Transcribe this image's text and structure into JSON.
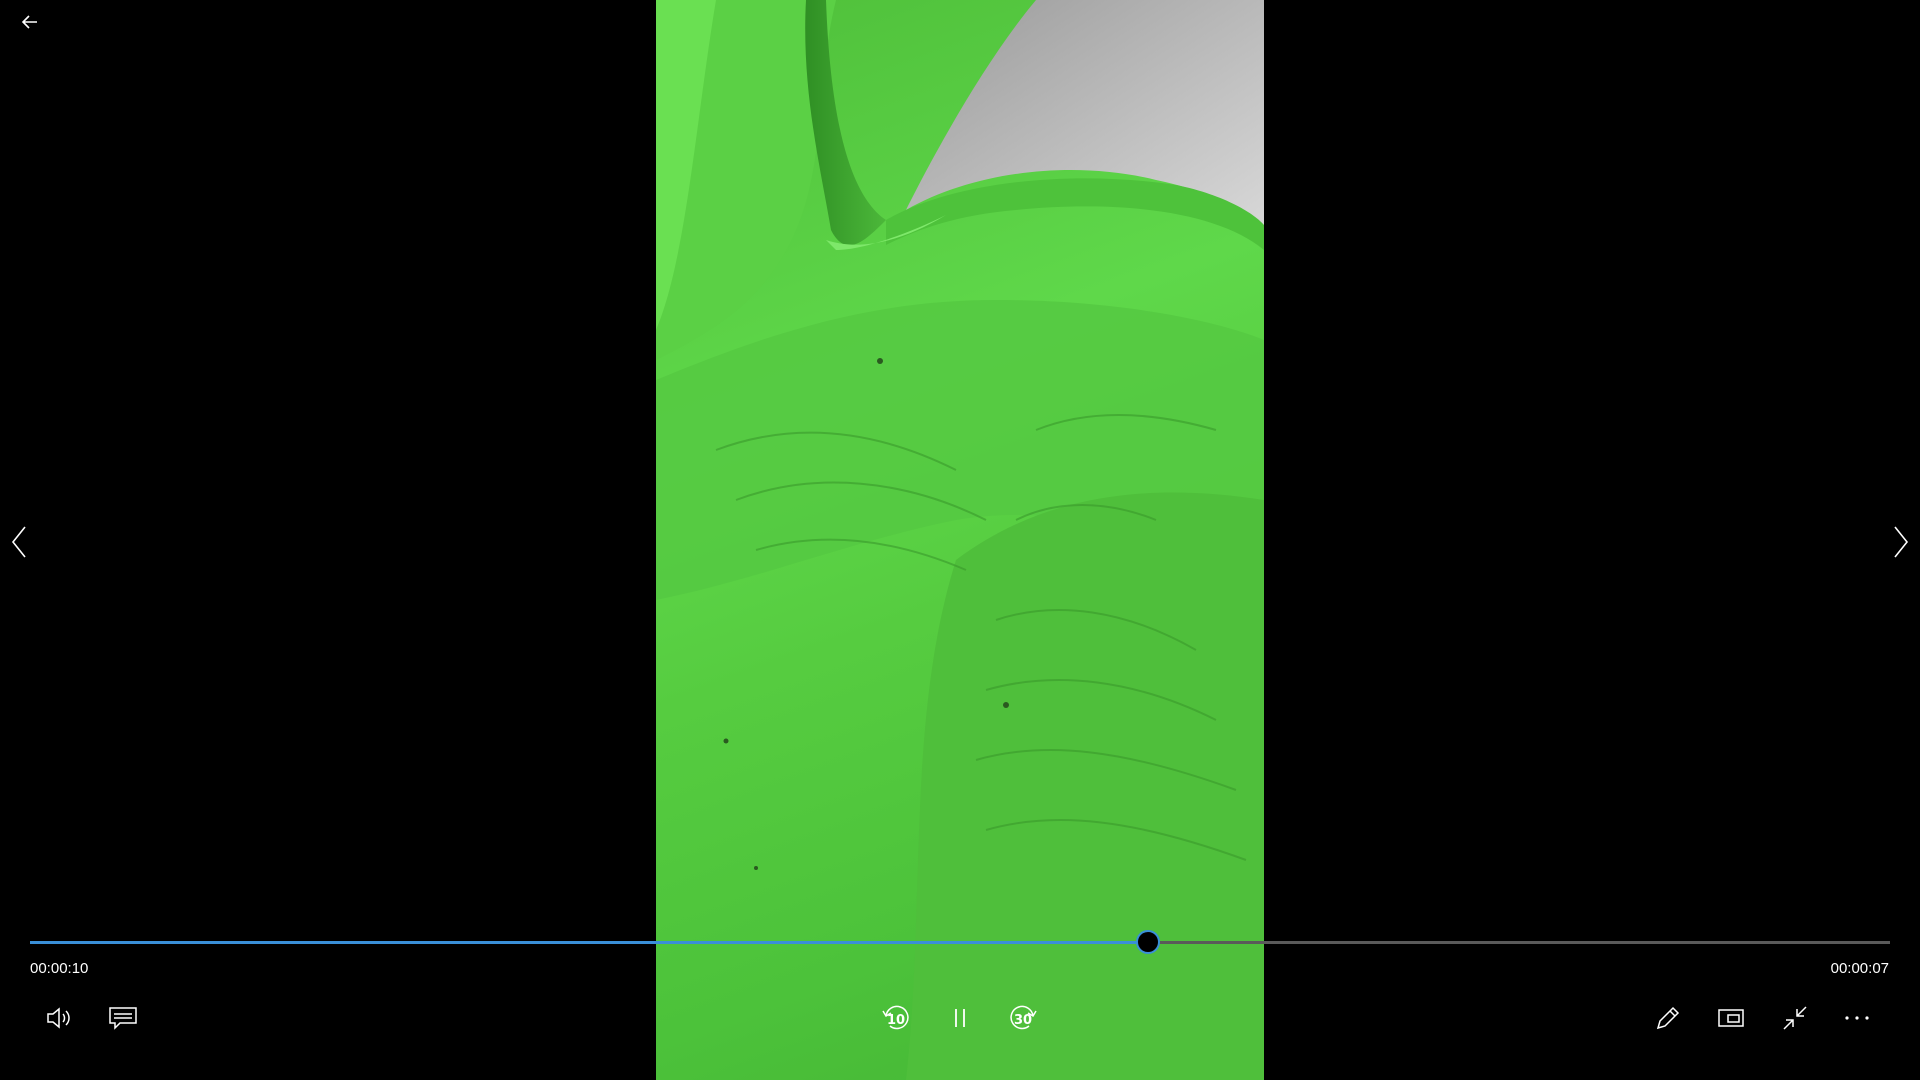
{
  "player": {
    "elapsed": "00:00:10",
    "remaining": "00:00:07",
    "progress_fraction": 0.601,
    "skip_back_seconds": "10",
    "skip_forward_seconds": "30",
    "state": "playing"
  },
  "icons": {
    "back": "arrow-left-icon",
    "prev": "chevron-left-icon",
    "next": "chevron-right-icon",
    "volume": "speaker-icon",
    "captions": "captions-icon",
    "skip_back": "rewind-10-icon",
    "pause": "pause-icon",
    "skip_forward": "forward-30-icon",
    "edit": "pencil-icon",
    "miniview": "mini-view-icon",
    "exit_fullscreen": "exit-fullscreen-icon",
    "more": "more-dots-icon"
  },
  "colors": {
    "accent": "#3a8fd8",
    "background": "#000000",
    "track": "#5a5a5a",
    "text": "#ffffff"
  }
}
